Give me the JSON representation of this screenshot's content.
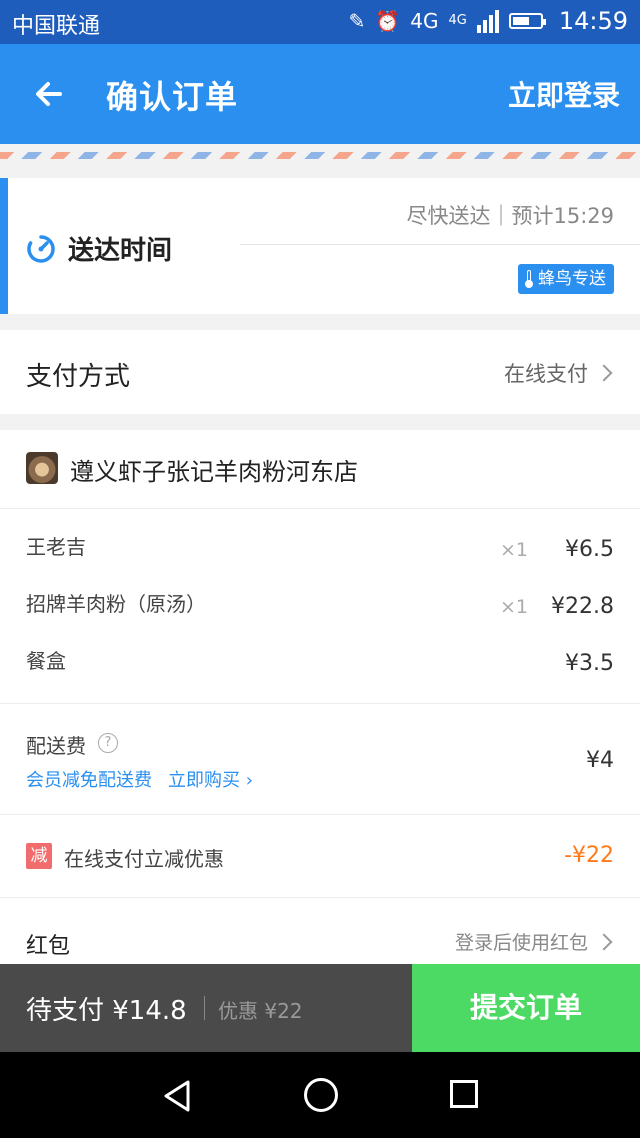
{
  "status_bar": {
    "carrier": "中国联通",
    "network": "4G",
    "network2": "4G",
    "time": "14:59"
  },
  "header": {
    "title": "确认订单",
    "login": "立即登录"
  },
  "delivery": {
    "label": "送达时间",
    "eta": "尽快送达｜预计15:29",
    "badge": "蜂鸟专送"
  },
  "payment": {
    "label": "支付方式",
    "value": "在线支付"
  },
  "shop": {
    "name": "遵义虾子张记羊肉粉河东店"
  },
  "items": [
    {
      "name": "王老吉",
      "qty": "×1",
      "price": "¥6.5"
    },
    {
      "name": "招牌羊肉粉（原汤）",
      "qty": "×1",
      "price": "¥22.8"
    },
    {
      "name": "餐盒",
      "qty": "",
      "price": "¥3.5"
    }
  ],
  "fee": {
    "label": "配送费",
    "help": "?",
    "promo": "会员减免配送费",
    "buy": "立即购买 ›",
    "price": "¥4"
  },
  "discount": {
    "badge": "减",
    "label": "在线支付立减优惠",
    "value": "-¥22"
  },
  "redpack": {
    "label": "红包",
    "value": "登录后使用红包"
  },
  "bottom": {
    "to_pay": "待支付 ¥14.8",
    "saved": "优惠 ¥22",
    "submit": "提交订单"
  },
  "colors": {
    "primary": "#2b8ff0",
    "submit": "#4cd964",
    "discount": "#ff7a1a"
  },
  "icons": [
    "back-arrow-icon",
    "clock-icon",
    "thermometer-icon",
    "chevron-right-icon",
    "help-icon",
    "nav-back-icon",
    "nav-home-icon",
    "nav-recent-icon"
  ]
}
